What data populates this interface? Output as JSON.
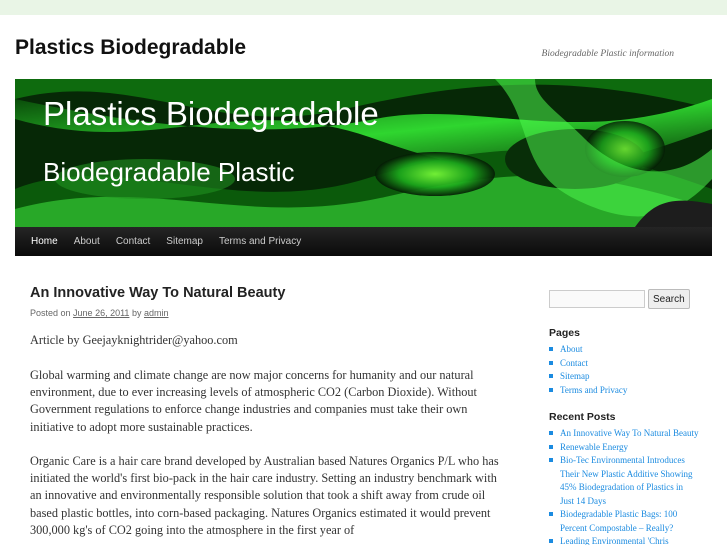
{
  "site": {
    "title": "Plastics Biodegradable",
    "tagline": "Biodegradable Plastic information"
  },
  "header_image": {
    "title": "Plastics Biodegradable",
    "subtitle": "Biodegradable Plastic"
  },
  "nav": {
    "items": [
      "Home",
      "About",
      "Contact",
      "Sitemap",
      "Terms and Privacy"
    ]
  },
  "post": {
    "title": "An Innovative Way To Natural Beauty",
    "meta_prefix": "Posted on",
    "date": "June 26, 2011",
    "by": "by",
    "author": "admin",
    "paragraphs": [
      "Article by Geejayknightrider@yahoo.com",
      "Global warming and climate change are now major concerns for humanity and our natural environment, due to ever increasing levels of atmospheric CO2 (Carbon Dioxide). Without Government regulations to enforce change industries and companies must take their own initiative to adopt more sustainable practices.",
      "Organic Care is a hair care brand developed by Australian based Natures Organics P/L who has initiated the world's first bio-pack in the hair care industry. Setting an industry benchmark with an innovative and environmentally responsible solution that took a shift away from crude oil based plastic bottles, into corn-based packaging. Natures Organics estimated it would prevent 300,000 kg's of CO2 going into the atmosphere in the first year of"
    ]
  },
  "sidebar": {
    "search_button": "Search",
    "pages_title": "Pages",
    "pages": [
      "About",
      "Contact",
      "Sitemap",
      "Terms and Privacy"
    ],
    "recent_title": "Recent Posts",
    "recent_posts": [
      "An Innovative Way To Natural Beauty",
      "Renewable Energy",
      "Bio-Tec Environmental Introduces Their New Plastic Additive Showing 45% Biodegradation of Plastics in Just 14 Days",
      "Biodegradable Plastic Bags: 100 Percent Compostable – Really?",
      "Leading Environmental 'Chris"
    ]
  },
  "colors": {
    "accent_link": "#1b8be0",
    "page_bg": "#e9f5e6",
    "nav_bg": "#1a1a1a"
  }
}
